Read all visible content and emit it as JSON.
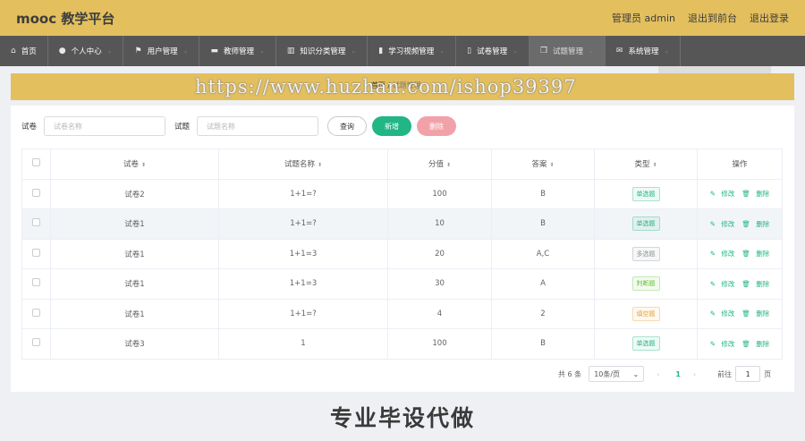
{
  "brand": "mooc 教学平台",
  "top_actions": {
    "user": "管理员 admin",
    "front": "退出到前台",
    "logout": "退出登录"
  },
  "nav": [
    {
      "label": "首页",
      "icon": "home-icon",
      "glyph": "⌂"
    },
    {
      "label": "个人中心",
      "icon": "user-icon",
      "glyph": "●"
    },
    {
      "label": "用户管理",
      "icon": "flag-icon",
      "glyph": "⚑"
    },
    {
      "label": "教师管理",
      "icon": "teacher-icon",
      "glyph": "▬"
    },
    {
      "label": "知识分类管理",
      "icon": "library-icon",
      "glyph": "▥"
    },
    {
      "label": "学习视频管理",
      "icon": "bar-chart-icon",
      "glyph": "▮"
    },
    {
      "label": "试卷管理",
      "icon": "paper-icon",
      "glyph": "▯"
    },
    {
      "label": "试题管理",
      "icon": "copy-icon",
      "glyph": "❐"
    },
    {
      "label": "系统管理",
      "icon": "message-icon",
      "glyph": "✉"
    }
  ],
  "breadcrumb": {
    "home": "首页",
    "sep": "/",
    "current": "试题管理"
  },
  "watermark": "https://www.huzhan.com/ishop39397",
  "search": {
    "paper_label": "试卷",
    "paper_placeholder": "试卷名称",
    "question_label": "试题",
    "question_placeholder": "试题名称",
    "query": "查询",
    "add": "新增",
    "delete": "删除"
  },
  "table": {
    "headers": [
      "试卷",
      "试题名称",
      "分值",
      "答案",
      "类型",
      "操作"
    ],
    "rows": [
      {
        "paper": "试卷2",
        "name": "1+1=?",
        "score": "100",
        "answer": "B",
        "type": "单选题",
        "color": "#22b585"
      },
      {
        "paper": "试卷1",
        "name": "1+1=?",
        "score": "10",
        "answer": "B",
        "type": "单选题",
        "color": "#22b585"
      },
      {
        "paper": "试卷1",
        "name": "1+1=3",
        "score": "20",
        "answer": "A,C",
        "type": "多选题",
        "color": "#909399"
      },
      {
        "paper": "试卷1",
        "name": "1+1=3",
        "score": "30",
        "answer": "A",
        "type": "判断题",
        "color": "#67c23a"
      },
      {
        "paper": "试卷1",
        "name": "1+1=?",
        "score": "4",
        "answer": "2",
        "type": "填空题",
        "color": "#e6a23c"
      },
      {
        "paper": "试卷3",
        "name": "1",
        "score": "100",
        "answer": "B",
        "type": "单选题",
        "color": "#22b585"
      }
    ],
    "edit": "修改",
    "remove": "删除"
  },
  "pager": {
    "total": "共 6 条",
    "page_size": "10条/页",
    "current": "1",
    "goto": "前往",
    "goto_value": "1",
    "page_unit": "页"
  },
  "banner": "专业毕设代做",
  "colors": {
    "topbar": "#e3bf5e",
    "nav": "#565656",
    "accent": "#22b585",
    "danger": "#f1a2a8"
  }
}
